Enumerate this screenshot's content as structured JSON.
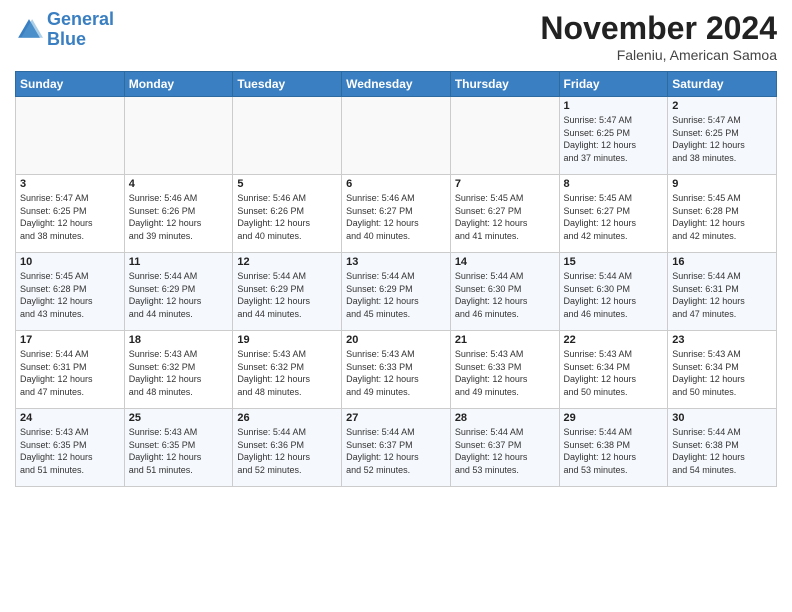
{
  "header": {
    "logo_line1": "General",
    "logo_line2": "Blue",
    "month_year": "November 2024",
    "location": "Faleniu, American Samoa"
  },
  "days_of_week": [
    "Sunday",
    "Monday",
    "Tuesday",
    "Wednesday",
    "Thursday",
    "Friday",
    "Saturday"
  ],
  "weeks": [
    [
      {
        "day": "",
        "info": ""
      },
      {
        "day": "",
        "info": ""
      },
      {
        "day": "",
        "info": ""
      },
      {
        "day": "",
        "info": ""
      },
      {
        "day": "",
        "info": ""
      },
      {
        "day": "1",
        "info": "Sunrise: 5:47 AM\nSunset: 6:25 PM\nDaylight: 12 hours\nand 37 minutes."
      },
      {
        "day": "2",
        "info": "Sunrise: 5:47 AM\nSunset: 6:25 PM\nDaylight: 12 hours\nand 38 minutes."
      }
    ],
    [
      {
        "day": "3",
        "info": "Sunrise: 5:47 AM\nSunset: 6:25 PM\nDaylight: 12 hours\nand 38 minutes."
      },
      {
        "day": "4",
        "info": "Sunrise: 5:46 AM\nSunset: 6:26 PM\nDaylight: 12 hours\nand 39 minutes."
      },
      {
        "day": "5",
        "info": "Sunrise: 5:46 AM\nSunset: 6:26 PM\nDaylight: 12 hours\nand 40 minutes."
      },
      {
        "day": "6",
        "info": "Sunrise: 5:46 AM\nSunset: 6:27 PM\nDaylight: 12 hours\nand 40 minutes."
      },
      {
        "day": "7",
        "info": "Sunrise: 5:45 AM\nSunset: 6:27 PM\nDaylight: 12 hours\nand 41 minutes."
      },
      {
        "day": "8",
        "info": "Sunrise: 5:45 AM\nSunset: 6:27 PM\nDaylight: 12 hours\nand 42 minutes."
      },
      {
        "day": "9",
        "info": "Sunrise: 5:45 AM\nSunset: 6:28 PM\nDaylight: 12 hours\nand 42 minutes."
      }
    ],
    [
      {
        "day": "10",
        "info": "Sunrise: 5:45 AM\nSunset: 6:28 PM\nDaylight: 12 hours\nand 43 minutes."
      },
      {
        "day": "11",
        "info": "Sunrise: 5:44 AM\nSunset: 6:29 PM\nDaylight: 12 hours\nand 44 minutes."
      },
      {
        "day": "12",
        "info": "Sunrise: 5:44 AM\nSunset: 6:29 PM\nDaylight: 12 hours\nand 44 minutes."
      },
      {
        "day": "13",
        "info": "Sunrise: 5:44 AM\nSunset: 6:29 PM\nDaylight: 12 hours\nand 45 minutes."
      },
      {
        "day": "14",
        "info": "Sunrise: 5:44 AM\nSunset: 6:30 PM\nDaylight: 12 hours\nand 46 minutes."
      },
      {
        "day": "15",
        "info": "Sunrise: 5:44 AM\nSunset: 6:30 PM\nDaylight: 12 hours\nand 46 minutes."
      },
      {
        "day": "16",
        "info": "Sunrise: 5:44 AM\nSunset: 6:31 PM\nDaylight: 12 hours\nand 47 minutes."
      }
    ],
    [
      {
        "day": "17",
        "info": "Sunrise: 5:44 AM\nSunset: 6:31 PM\nDaylight: 12 hours\nand 47 minutes."
      },
      {
        "day": "18",
        "info": "Sunrise: 5:43 AM\nSunset: 6:32 PM\nDaylight: 12 hours\nand 48 minutes."
      },
      {
        "day": "19",
        "info": "Sunrise: 5:43 AM\nSunset: 6:32 PM\nDaylight: 12 hours\nand 48 minutes."
      },
      {
        "day": "20",
        "info": "Sunrise: 5:43 AM\nSunset: 6:33 PM\nDaylight: 12 hours\nand 49 minutes."
      },
      {
        "day": "21",
        "info": "Sunrise: 5:43 AM\nSunset: 6:33 PM\nDaylight: 12 hours\nand 49 minutes."
      },
      {
        "day": "22",
        "info": "Sunrise: 5:43 AM\nSunset: 6:34 PM\nDaylight: 12 hours\nand 50 minutes."
      },
      {
        "day": "23",
        "info": "Sunrise: 5:43 AM\nSunset: 6:34 PM\nDaylight: 12 hours\nand 50 minutes."
      }
    ],
    [
      {
        "day": "24",
        "info": "Sunrise: 5:43 AM\nSunset: 6:35 PM\nDaylight: 12 hours\nand 51 minutes."
      },
      {
        "day": "25",
        "info": "Sunrise: 5:43 AM\nSunset: 6:35 PM\nDaylight: 12 hours\nand 51 minutes."
      },
      {
        "day": "26",
        "info": "Sunrise: 5:44 AM\nSunset: 6:36 PM\nDaylight: 12 hours\nand 52 minutes."
      },
      {
        "day": "27",
        "info": "Sunrise: 5:44 AM\nSunset: 6:37 PM\nDaylight: 12 hours\nand 52 minutes."
      },
      {
        "day": "28",
        "info": "Sunrise: 5:44 AM\nSunset: 6:37 PM\nDaylight: 12 hours\nand 53 minutes."
      },
      {
        "day": "29",
        "info": "Sunrise: 5:44 AM\nSunset: 6:38 PM\nDaylight: 12 hours\nand 53 minutes."
      },
      {
        "day": "30",
        "info": "Sunrise: 5:44 AM\nSunset: 6:38 PM\nDaylight: 12 hours\nand 54 minutes."
      }
    ]
  ]
}
